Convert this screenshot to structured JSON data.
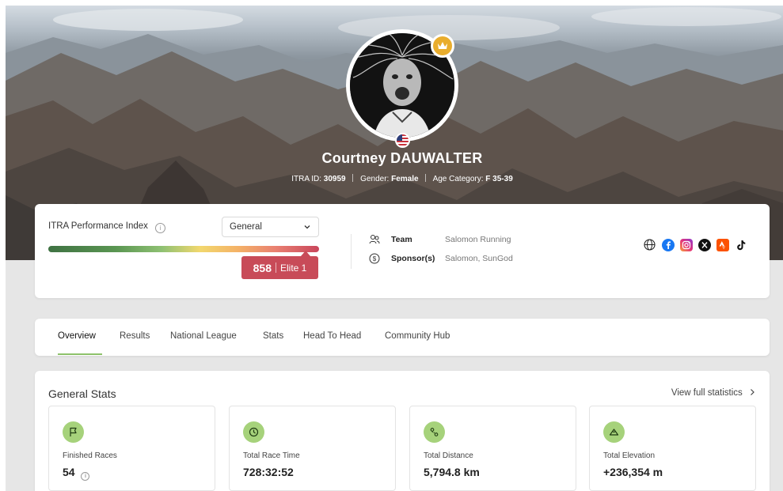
{
  "profile": {
    "name": "Courtney DAUWALTER",
    "itra_id_label": "ITRA ID:",
    "itra_id": "30959",
    "gender_label": "Gender:",
    "gender": "Female",
    "age_category_label": "Age Category:",
    "age_category": "F 35-39",
    "badge_icon": "crown-icon",
    "flag_icon": "us-flag-icon"
  },
  "performance": {
    "label": "ITRA Performance Index",
    "select_value": "General",
    "score": "858",
    "level": "Elite 1",
    "fill_fraction": 0.95
  },
  "affiliation": {
    "team_label": "Team",
    "team": "Salomon Running",
    "sponsor_label": "Sponsor(s)",
    "sponsors": "Salomon, SunGod"
  },
  "socials": [
    "globe-icon",
    "facebook-icon",
    "instagram-icon",
    "x-icon",
    "strava-icon",
    "tiktok-icon"
  ],
  "tabs": [
    {
      "label": "Overview",
      "active": true
    },
    {
      "label": "Results"
    },
    {
      "label": "National League"
    },
    {
      "label": "Stats"
    },
    {
      "label": "Head To Head"
    },
    {
      "label": "Community Hub"
    }
  ],
  "general_stats": {
    "title": "General Stats",
    "view_full": "View full statistics",
    "items": [
      {
        "label": "Finished Races",
        "value": "54",
        "icon": "flag-icon"
      },
      {
        "label": "Total Race Time",
        "value": "728:32:52",
        "icon": "clock-icon"
      },
      {
        "label": "Total Distance",
        "value": "5,794.8 km",
        "icon": "distance-icon"
      },
      {
        "label": "Total Elevation",
        "value": "+236,354 m",
        "icon": "mountain-icon"
      }
    ]
  },
  "colors": {
    "accent_green": "#a6d27b",
    "tab_underline": "#8dc26a",
    "score_red": "#c84b58",
    "crown_gold": "#e9ad2d"
  }
}
